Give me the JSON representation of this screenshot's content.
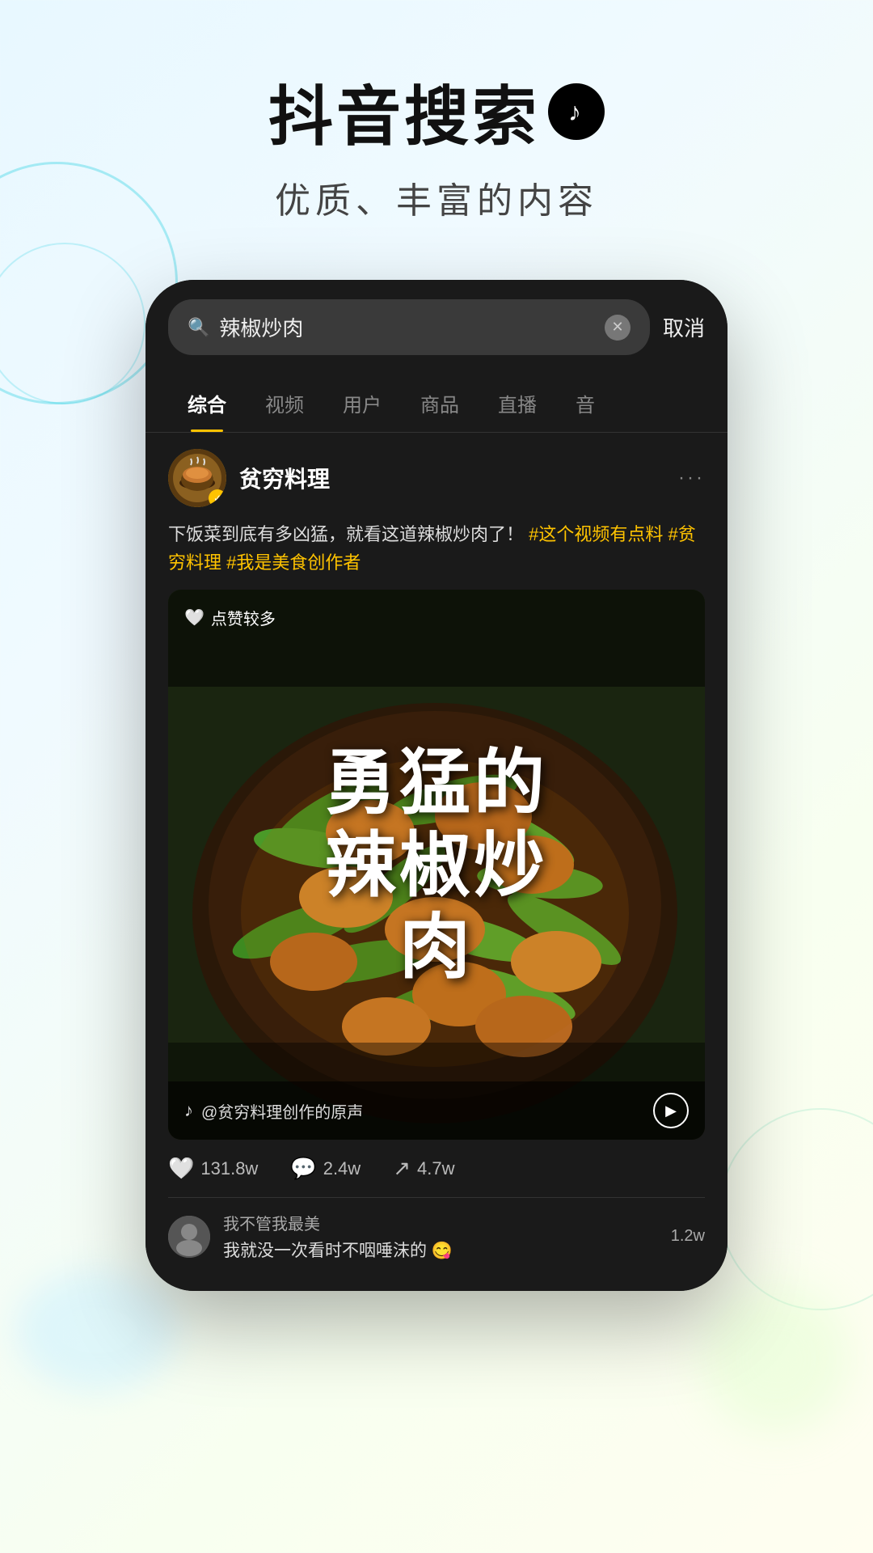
{
  "header": {
    "title": "抖音搜索",
    "logo_symbol": "♪",
    "subtitle": "优质、丰富的内容"
  },
  "phone": {
    "search": {
      "placeholder": "辣椒炒肉",
      "cancel_label": "取消"
    },
    "tabs": [
      {
        "label": "综合",
        "active": true
      },
      {
        "label": "视频",
        "active": false
      },
      {
        "label": "用户",
        "active": false
      },
      {
        "label": "商品",
        "active": false
      },
      {
        "label": "直播",
        "active": false
      },
      {
        "label": "音",
        "active": false
      }
    ],
    "post": {
      "username": "贫穷料理",
      "verified": true,
      "text_before": "下饭菜到底有多凶猛，就看这道辣椒炒肉了！",
      "hashtags": [
        "#这个视频有点料",
        "#贫穷料理",
        "#我是美食创作者"
      ],
      "likes_badge": "点赞较多",
      "video_text": "勇猛的辣椒炒肉",
      "audio_label": "@贫穷料理创作的原声",
      "stats": {
        "likes": "131.8w",
        "comments": "2.4w",
        "shares": "4.7w"
      }
    },
    "comment": {
      "username": "我不管我最美",
      "text": "我就没一次看时不咽唾沫的 😋",
      "likes": "1.2w"
    }
  }
}
